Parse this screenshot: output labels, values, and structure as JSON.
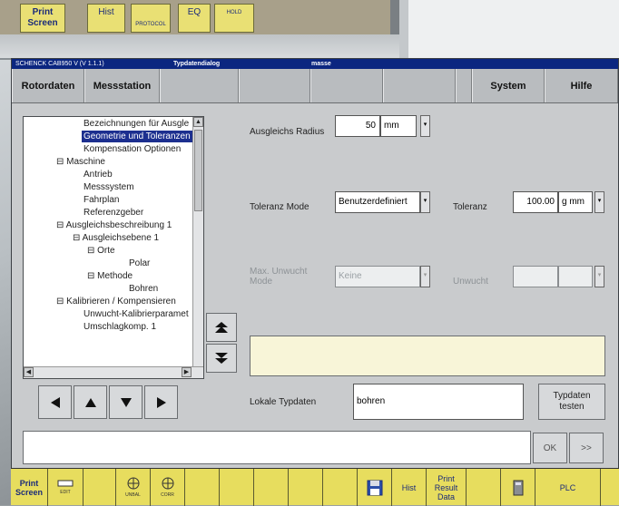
{
  "background": {
    "old_keys": [
      "Print Screen",
      "Hist",
      "PROTOCOL",
      "EQ",
      "HOLD"
    ]
  },
  "window": {
    "title_left": "SCHENCK   CAB950 V (V 1.1.1)",
    "title_center": "Typdatendialog",
    "title_right": "masse"
  },
  "menu": [
    "Rotordaten",
    "Messstation",
    "",
    "",
    "",
    "",
    "",
    "System",
    "Hilfe"
  ],
  "tree": {
    "items": [
      {
        "label": "Bezeichnungen für Ausgle",
        "selected": false
      },
      {
        "label": "Geometrie und Toleranzen",
        "selected": true
      },
      {
        "label": "Kompensation Optionen",
        "selected": false
      },
      {
        "label": "⊟ Maschine",
        "selected": false
      },
      {
        "label": "Antrieb",
        "selected": false
      },
      {
        "label": "Messsystem",
        "selected": false
      },
      {
        "label": "Fahrplan",
        "selected": false
      },
      {
        "label": "Referenzgeber",
        "selected": false
      },
      {
        "label": "⊟ Ausgleichsbeschreibung 1",
        "selected": false
      },
      {
        "label": "⊟ Ausgleichsebene 1",
        "selected": false
      },
      {
        "label": "⊟ Orte",
        "selected": false
      },
      {
        "label": "Polar",
        "selected": false
      },
      {
        "label": "⊟ Methode",
        "selected": false
      },
      {
        "label": "Bohren",
        "selected": false
      },
      {
        "label": "⊟ Kalibrieren / Kompensieren",
        "selected": false
      },
      {
        "label": "Unwucht-Kalibrierparamet",
        "selected": false
      },
      {
        "label": "Umschlagkomp. 1",
        "selected": false
      }
    ]
  },
  "form": {
    "ausgleichs_radius_label": "Ausgleichs Radius",
    "ausgleichs_radius_value": "50",
    "ausgleichs_radius_unit": "mm",
    "toleranz_mode_label": "Toleranz Mode",
    "toleranz_mode_value": "Benutzerdefiniert",
    "toleranz_label": "Toleranz",
    "toleranz_value": "100.00",
    "toleranz_unit": "g mm",
    "max_unwucht_mode_label": "Max. Unwucht Mode",
    "max_unwucht_mode_value": "Keine",
    "unwucht_label": "Unwucht",
    "lokale_typdaten_label": "Lokale Typdaten",
    "lokale_typdaten_value": "bohren",
    "typdaten_testen_label": "Typdaten testen"
  },
  "buttons": {
    "ok": "OK",
    "next": ">>"
  },
  "fkeys": [
    {
      "label": "Print Screen",
      "bold": true
    },
    {
      "label": "EDIT",
      "icon": "edit-icon"
    },
    {
      "label": "",
      "icon": ""
    },
    {
      "label": "UNBAL",
      "icon": "unbal-icon"
    },
    {
      "label": "CORR",
      "icon": "corr-icon"
    },
    {
      "label": "",
      "icon": ""
    },
    {
      "label": "",
      "icon": ""
    },
    {
      "label": "",
      "icon": ""
    },
    {
      "label": "",
      "icon": ""
    },
    {
      "label": "",
      "icon": ""
    },
    {
      "label": "",
      "icon": "floppy-icon"
    },
    {
      "label": "Hist",
      "icon": ""
    },
    {
      "label": "Print Result Data",
      "icon": ""
    },
    {
      "label": "",
      "icon": ""
    },
    {
      "label": "",
      "icon": "calculator-icon"
    },
    {
      "label": "PLC",
      "icon": ""
    }
  ],
  "colors": {
    "titlebar": "#0b2680",
    "fkey_bar": "#e7dd5e",
    "selection": "#1c2f8f",
    "message_area": "#f8f5d8"
  }
}
